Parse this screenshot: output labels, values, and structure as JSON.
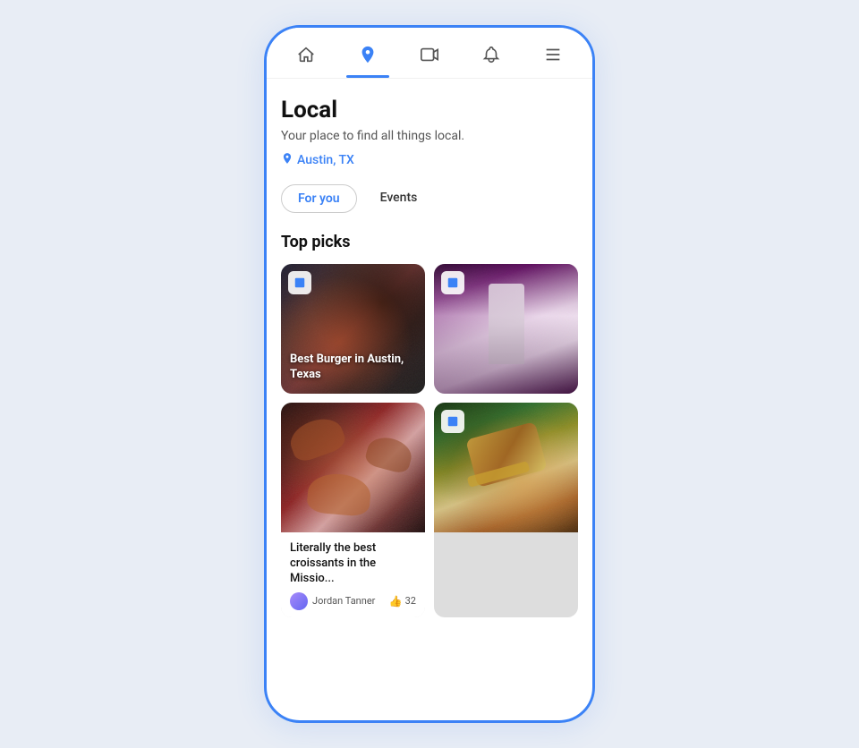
{
  "nav": {
    "items": [
      {
        "id": "home",
        "label": "Home",
        "active": false
      },
      {
        "id": "local",
        "label": "Local",
        "active": true
      },
      {
        "id": "video",
        "label": "Video",
        "active": false
      },
      {
        "id": "notifications",
        "label": "Notifications",
        "active": false
      },
      {
        "id": "menu",
        "label": "Menu",
        "active": false
      }
    ]
  },
  "page": {
    "title": "Local",
    "subtitle": "Your place to find all things local.",
    "location": "Austin, TX"
  },
  "tabs": [
    {
      "id": "for-you",
      "label": "For you",
      "active": true
    },
    {
      "id": "events",
      "label": "Events",
      "active": false
    }
  ],
  "section": {
    "title": "Top picks"
  },
  "cards": [
    {
      "id": "card-1",
      "type": "overlay",
      "overlay_text": "Best Burger in Austin, Texas",
      "has_badge": true
    },
    {
      "id": "card-2",
      "type": "simple",
      "has_badge": true
    },
    {
      "id": "card-3",
      "type": "with-bottom",
      "has_badge": false,
      "bottom_title": "Literally the best croissants in the Missio...",
      "author": "Jordan Tanner",
      "likes": "32"
    },
    {
      "id": "card-4",
      "type": "simple",
      "has_badge": true
    }
  ]
}
